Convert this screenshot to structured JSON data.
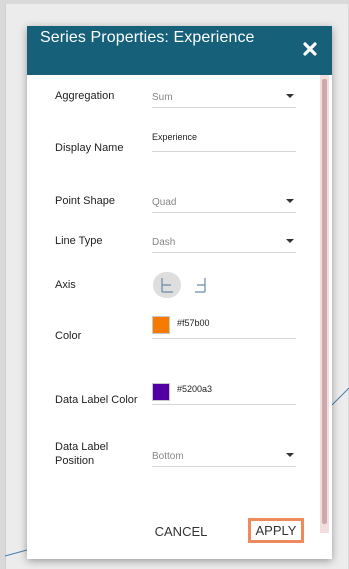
{
  "dialog": {
    "title": "Series Properties: Experience",
    "close_icon": "close-icon"
  },
  "fields": {
    "aggregation": {
      "label": "Aggregation",
      "value": "Sum"
    },
    "display_name": {
      "label": "Display Name",
      "value": "Experience"
    },
    "point_shape": {
      "label": "Point Shape",
      "value": "Quad"
    },
    "line_type": {
      "label": "Line Type",
      "value": "Dash"
    },
    "axis": {
      "label": "Axis",
      "left_icon": "axis-left-icon",
      "right_icon": "axis-right-icon",
      "selected": "left"
    },
    "color": {
      "label": "Color",
      "value": "#f57b00",
      "swatch": "#f57b00"
    },
    "data_label_color": {
      "label": "Data Label Color",
      "value": "#5200a3",
      "swatch": "#5200a3"
    },
    "data_label_position": {
      "label": "Data Label\nPosition",
      "label_line1": "Data Label",
      "label_line2": "Position",
      "value": "Bottom"
    }
  },
  "footer": {
    "cancel_label": "CANCEL",
    "apply_label": "APPLY"
  },
  "colors": {
    "header_bg": "#16607a",
    "apply_border": "#ef8a5c"
  }
}
